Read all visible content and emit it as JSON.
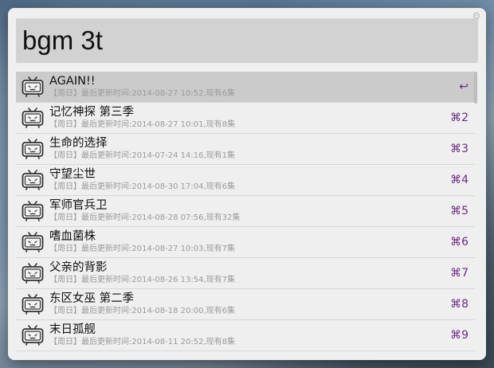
{
  "search": {
    "query": "bgm 3t"
  },
  "icons": {
    "settings": "gear-icon",
    "item": "tv-icon"
  },
  "colors": {
    "accent": "#6c2a86",
    "selected_row": "#cbcbcb",
    "search_field": "#d2d2d2"
  },
  "results": [
    {
      "title": "AGAIN!!",
      "subtitle": "【周日】最后更新时间:2014-08-27 10:52,现有6集",
      "shortcut": "↩"
    },
    {
      "title": "记忆神探 第三季",
      "subtitle": "【周日】最后更新时间:2014-08-27 10:01,现有8集",
      "shortcut": "⌘2"
    },
    {
      "title": "生命的选择",
      "subtitle": "【周日】最后更新时间:2014-07-24 14:16,现有1集",
      "shortcut": "⌘3"
    },
    {
      "title": "守望尘世",
      "subtitle": "【周日】最后更新时间:2014-08-30 17:04,现有6集",
      "shortcut": "⌘4"
    },
    {
      "title": "军师官兵卫",
      "subtitle": "【周日】最后更新时间:2014-08-28 07:56,现有32集",
      "shortcut": "⌘5"
    },
    {
      "title": "嗜血菌株",
      "subtitle": "【周日】最后更新时间:2014-08-27 10:03,现有7集",
      "shortcut": "⌘6"
    },
    {
      "title": "父亲的背影",
      "subtitle": "【周日】最后更新时间:2014-08-26 13:54,现有7集",
      "shortcut": "⌘7"
    },
    {
      "title": "东区女巫 第二季",
      "subtitle": "【周日】最后更新时间:2014-08-18 20:00,现有6集",
      "shortcut": "⌘8"
    },
    {
      "title": "末日孤舰",
      "subtitle": "【周日】最后更新时间:2014-08-11 20:52,现有8集",
      "shortcut": "⌘9"
    }
  ]
}
